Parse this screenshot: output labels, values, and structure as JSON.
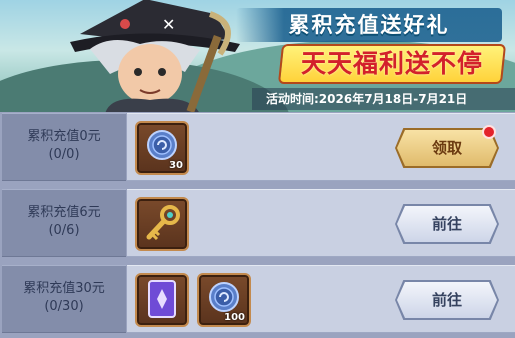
{
  "banner": {
    "title_top": "累积充值送好礼",
    "title_main": "天天福利送不停",
    "time_label": "活动时间:2026年7月18日-7月21日"
  },
  "rows": [
    {
      "label": "累积充值0元",
      "progress": "(0/0)",
      "items": [
        {
          "icon": "coin-icon",
          "count": "30"
        }
      ],
      "button": {
        "label": "领取",
        "style": "claim",
        "has_red_dot": true
      }
    },
    {
      "label": "累积充值6元",
      "progress": "(0/6)",
      "items": [
        {
          "icon": "key-icon",
          "count": ""
        }
      ],
      "button": {
        "label": "前往",
        "style": "go",
        "has_red_dot": false
      }
    },
    {
      "label": "累积充值30元",
      "progress": "(0/30)",
      "items": [
        {
          "icon": "card-icon",
          "count": ""
        },
        {
          "icon": "coin-icon",
          "count": "100"
        }
      ],
      "button": {
        "label": "前往",
        "style": "go",
        "has_red_dot": false
      }
    }
  ],
  "colors": {
    "claim_button": "#e9c77e",
    "go_button": "#e4e9f4",
    "red_dot": "#e3222a",
    "panel": "#c9d0e2"
  }
}
